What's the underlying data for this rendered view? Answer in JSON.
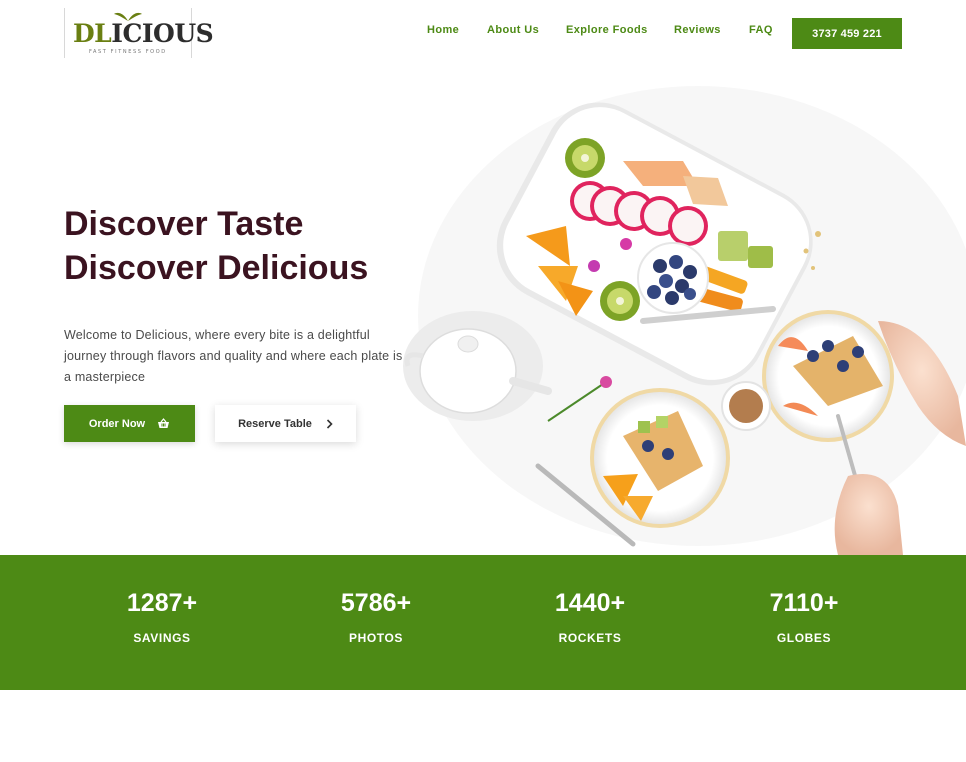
{
  "brand": {
    "logo_dl": "DL",
    "logo_rest": "ICIOUS",
    "tagline": "FAST FITNESS FOOD",
    "accent_color": "#4d8a15",
    "title_color": "#3b1320"
  },
  "nav": {
    "items": [
      {
        "label": "Home"
      },
      {
        "label": "About Us"
      },
      {
        "label": "Explore Foods"
      },
      {
        "label": "Reviews"
      },
      {
        "label": "FAQ"
      }
    ],
    "phone": "3737 459 221"
  },
  "hero": {
    "title_line1": "Discover Taste",
    "title_line2": "Discover Delicious",
    "description": "Welcome to Delicious, where every bite is a delightful journey through flavors and quality and where each plate is a masterpiece",
    "order_label": "Order Now",
    "order_icon": "basket-icon",
    "reserve_label": "Reserve Table",
    "reserve_icon": "chevron-right-icon"
  },
  "stats": [
    {
      "value": "1287+",
      "label": "SAVINGS"
    },
    {
      "value": "5786+",
      "label": "PHOTOS"
    },
    {
      "value": "1440+",
      "label": "ROCKETS"
    },
    {
      "value": "7110+",
      "label": "GLOBES"
    }
  ]
}
